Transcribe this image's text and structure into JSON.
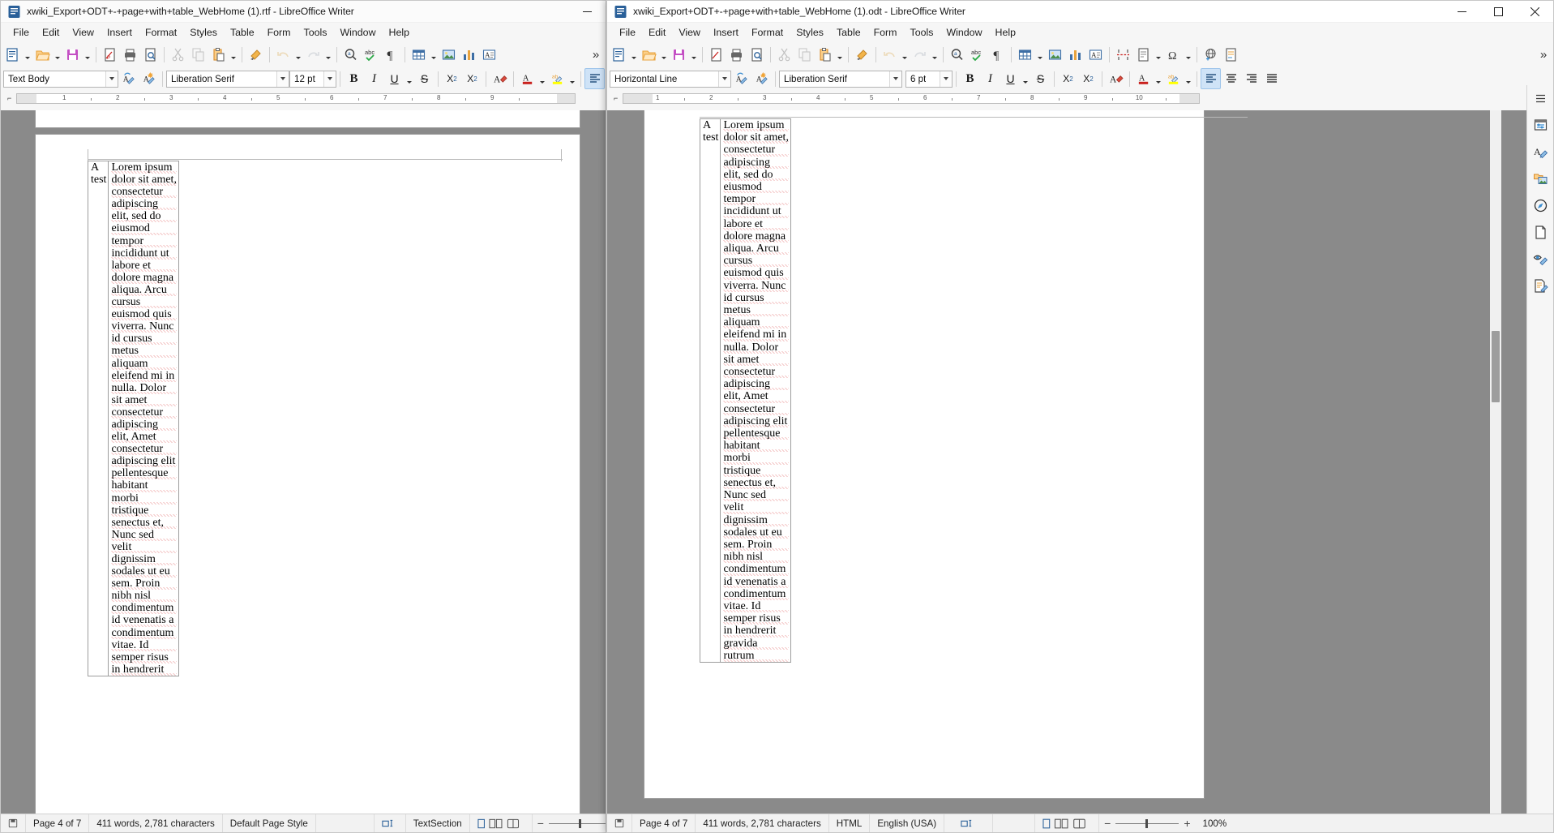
{
  "app": {
    "name": "LibreOffice Writer"
  },
  "windows": [
    {
      "id": "left",
      "title": "xwiki_Export+ODT+-+page+with+table_WebHome (1).rtf - LibreOffice Writer",
      "menus": [
        "File",
        "Edit",
        "View",
        "Insert",
        "Format",
        "Styles",
        "Table",
        "Form",
        "Tools",
        "Window",
        "Help"
      ],
      "paragraph_style": "Text Body",
      "font_name": "Liberation Serif",
      "font_size": "12 pt",
      "status": {
        "page": "Page 4 of 7",
        "words": "411 words, 2,781 characters",
        "page_style": "Default Page Style",
        "language": "",
        "section": "TextSection",
        "zoom": ""
      },
      "controls": {
        "minimize": "minimize",
        "maximize": "maximize",
        "close": "close"
      }
    },
    {
      "id": "right",
      "title": "xwiki_Export+ODT+-+page+with+table_WebHome (1).odt - LibreOffice Writer",
      "menus": [
        "File",
        "Edit",
        "View",
        "Insert",
        "Format",
        "Styles",
        "Table",
        "Form",
        "Tools",
        "Window",
        "Help"
      ],
      "paragraph_style": "Horizontal Line",
      "font_name": "Liberation Serif",
      "font_size": "6 pt",
      "status": {
        "page": "Page 4 of 7",
        "words": "411 words, 2,781 characters",
        "page_style": "HTML",
        "language": "English (USA)",
        "section": "",
        "zoom": "100%"
      },
      "controls": {
        "minimize": "minimize",
        "maximize": "maximize",
        "close": "close"
      }
    }
  ],
  "toolbar_items": [
    "new-document-icon",
    "open-icon",
    "save-icon",
    "export-pdf-icon",
    "print-icon",
    "print-preview-icon",
    "cut-icon",
    "copy-icon",
    "paste-icon",
    "clone-formatting-icon",
    "undo-icon",
    "redo-icon",
    "find-replace-icon",
    "spelling-icon",
    "formatting-marks-icon",
    "insert-table-icon",
    "insert-image-icon",
    "insert-chart-icon",
    "insert-text-box-icon",
    "insert-page-break-icon",
    "insert-field-icon",
    "insert-special-character-icon",
    "insert-hyperlink-icon",
    "insert-footnote-icon"
  ],
  "format_items": [
    "update-style-icon",
    "new-style-icon",
    "bold-icon",
    "italic-icon",
    "underline-icon",
    "strikethrough-icon",
    "superscript-icon",
    "subscript-icon",
    "clear-formatting-icon",
    "font-color-icon",
    "highlight-color-icon",
    "align-left-icon",
    "align-center-icon",
    "align-right-icon",
    "align-justified-icon"
  ],
  "sidebar_rail": [
    {
      "name": "sidebar-settings-icon",
      "title": "Sidebar Settings"
    },
    {
      "name": "properties-icon",
      "title": "Properties"
    },
    {
      "name": "styles-icon",
      "title": "Styles"
    },
    {
      "name": "gallery-icon",
      "title": "Gallery"
    },
    {
      "name": "navigator-icon",
      "title": "Navigator"
    },
    {
      "name": "page-icon",
      "title": "Page"
    },
    {
      "name": "style-inspector-icon",
      "title": "Style Inspector"
    },
    {
      "name": "accessibility-check-icon",
      "title": "Accessibility Check"
    }
  ],
  "document": {
    "table": {
      "col1": [
        "A",
        "test"
      ],
      "col2_left": [
        "Lorem ipsum",
        "dolor sit amet,",
        "consectetur",
        "adipiscing",
        "elit, sed do",
        "eiusmod",
        "tempor",
        "incididunt ut",
        "labore et",
        "dolore magna",
        "aliqua. Arcu",
        "cursus",
        "euismod quis",
        "viverra. Nunc",
        "id cursus",
        "metus",
        "aliquam",
        "eleifend mi in",
        "nulla. Dolor",
        "sit amet",
        "consectetur",
        "adipiscing",
        "elit, Amet",
        "consectetur",
        "adipiscing elit",
        "pellentesque",
        "habitant",
        "morbi",
        "tristique",
        "senectus et,",
        "Nunc sed",
        "velit",
        "dignissim",
        "sodales ut eu",
        "sem. Proin",
        "nibh nisl",
        "condimentum",
        "id venenatis a",
        "condimentum",
        "vitae. Id",
        "semper risus",
        "in hendrerit"
      ],
      "col2_right": [
        "Lorem ipsum",
        "dolor sit amet,",
        "consectetur",
        "adipiscing",
        "elit, sed do",
        "eiusmod",
        "tempor",
        "incididunt ut",
        "labore et",
        "dolore magna",
        "aliqua. Arcu",
        "cursus",
        "euismod quis",
        "viverra. Nunc",
        "id cursus",
        "metus",
        "aliquam",
        "eleifend mi in",
        "nulla. Dolor",
        "sit amet",
        "consectetur",
        "adipiscing",
        "elit, Amet",
        "consectetur",
        "adipiscing elit",
        "pellentesque",
        "habitant",
        "morbi",
        "tristique",
        "senectus et,",
        "Nunc sed",
        "velit",
        "dignissim",
        "sodales ut eu",
        "sem. Proin",
        "nibh nisl",
        "condimentum",
        "id venenatis a",
        "condimentum",
        "vitae. Id",
        "semper risus",
        "in hendrerit",
        "gravida",
        "rutrum"
      ]
    }
  },
  "colors": {
    "accent": "#2a6099",
    "highlight": "#ffff00",
    "font_color": "#c9211e",
    "selected_tool": "#cfe3f7"
  }
}
